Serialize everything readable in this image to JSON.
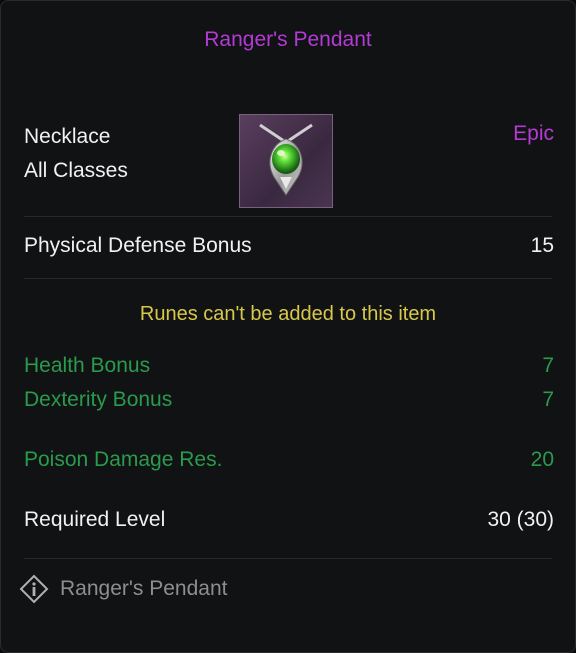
{
  "item": {
    "name": "Ranger's Pendant",
    "type": "Necklace",
    "classes": "All Classes",
    "rarity": "Epic",
    "icon": "green-gem-pendant-icon"
  },
  "base_stats": [
    {
      "label": "Physical Defense Bonus",
      "value": "15"
    }
  ],
  "notice": "Runes can't be added to this item",
  "bonus_stats": [
    {
      "label": "Health Bonus",
      "value": "7"
    },
    {
      "label": "Dexterity Bonus",
      "value": "7"
    }
  ],
  "resist_stats": [
    {
      "label": "Poison Damage Res.",
      "value": "20"
    }
  ],
  "requirement": {
    "label": "Required Level",
    "value": "30 (30)"
  },
  "footer": {
    "icon": "info-diamond-icon",
    "text": "Ranger's Pendant"
  },
  "colors": {
    "epic": "#b43ad6",
    "bonus_green": "#2a9a4c",
    "notice_yellow": "#d8c84a"
  }
}
